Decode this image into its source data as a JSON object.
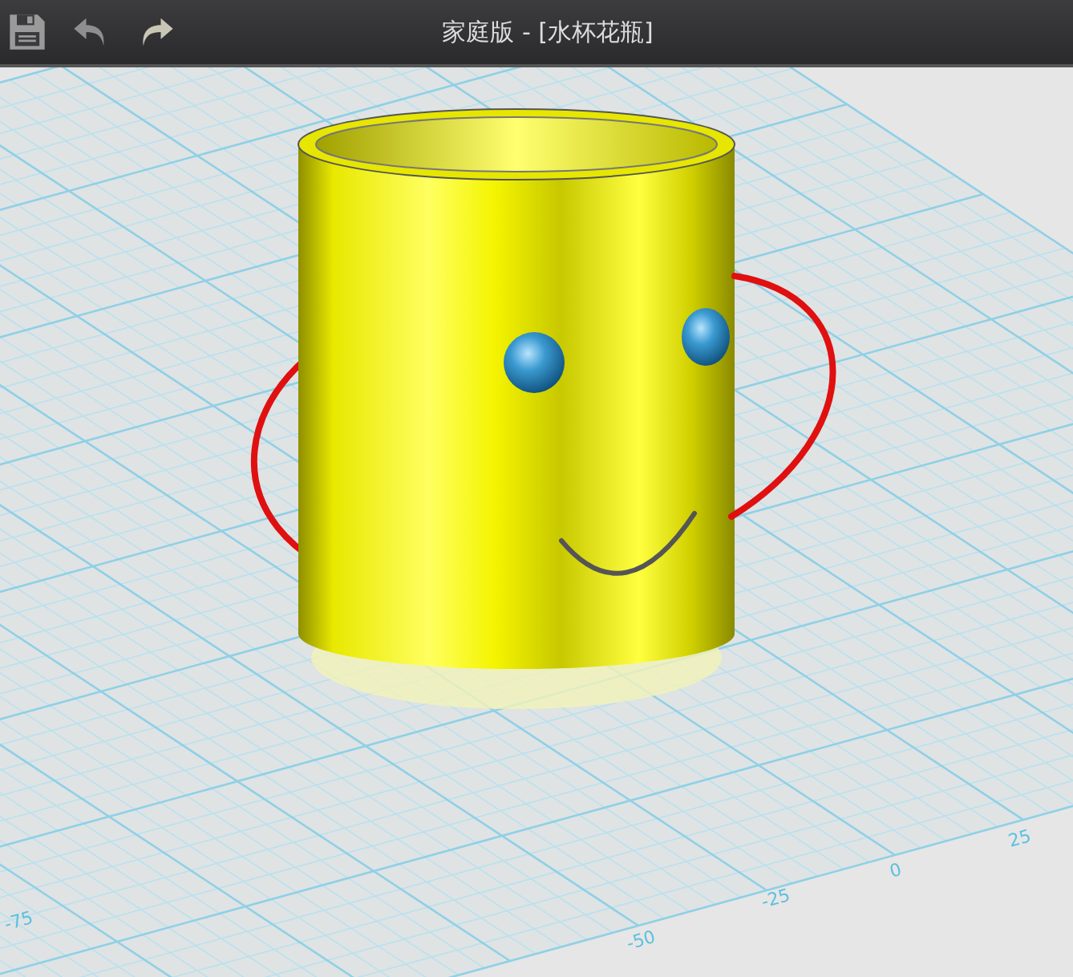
{
  "toolbar": {
    "title": "家庭版 - [水杯花瓶]"
  },
  "viewport": {
    "axis_labels": [
      {
        "text": "-75"
      },
      {
        "text": "-50"
      },
      {
        "text": "-25"
      },
      {
        "text": "0"
      },
      {
        "text": "25"
      }
    ]
  }
}
